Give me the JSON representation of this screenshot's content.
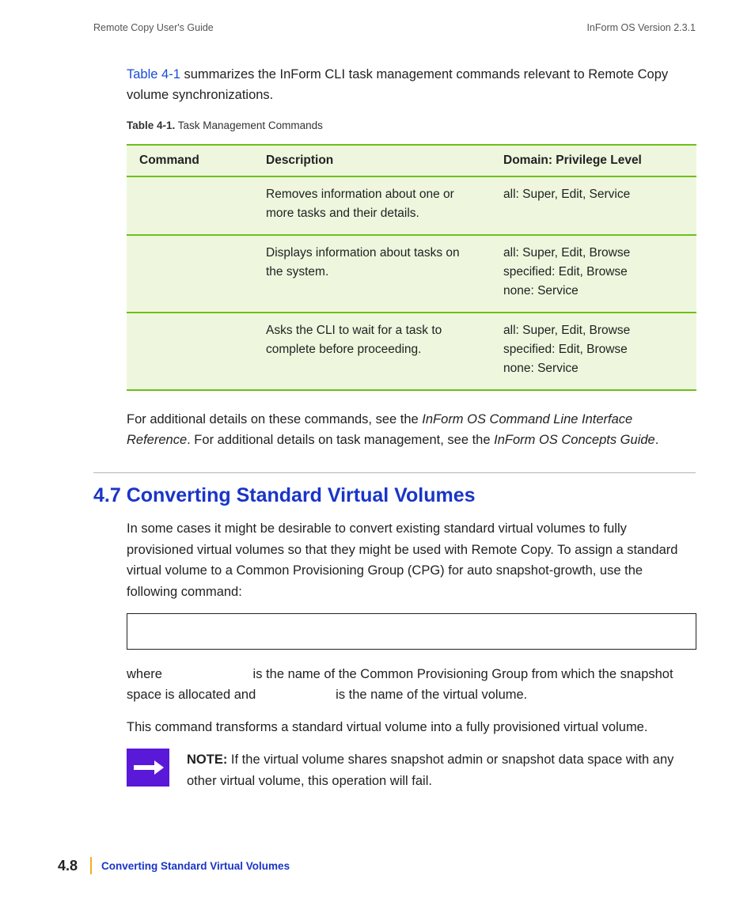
{
  "header": {
    "left": "Remote Copy User's Guide",
    "right": "InForm OS Version 2.3.1"
  },
  "intro": {
    "link": "Table 4-1",
    "rest": " summarizes the InForm CLI task management commands relevant to Remote Copy volume synchronizations."
  },
  "table": {
    "caption_label": "Table 4-1.",
    "caption_text": "  Task Management Commands",
    "headers": {
      "command": "Command",
      "description": "Description",
      "domain": "Domain: Privilege Level"
    },
    "rows": [
      {
        "command": "",
        "description": "Removes information about one or more tasks and their details.",
        "domain": "all: Super, Edit, Service"
      },
      {
        "command": "",
        "description": "Displays information about tasks on the system.",
        "domain": "all: Super, Edit, Browse\nspecified: Edit, Browse\nnone: Service"
      },
      {
        "command": "",
        "description": "Asks the CLI to wait for a task to complete before proceeding.",
        "domain": "all: Super, Edit, Browse\nspecified: Edit, Browse\nnone: Service"
      }
    ]
  },
  "after_table": {
    "p1_a": "For additional details on these commands, see the ",
    "p1_i1": "InForm OS Command Line Interface Reference",
    "p1_b": ". For additional details on task management, see the ",
    "p1_i2": "InForm OS Concepts Guide",
    "p1_c": "."
  },
  "section": {
    "heading": "4.7  Converting Standard Virtual Volumes",
    "p1": "In some cases it might be desirable to convert existing standard virtual volumes to fully provisioned virtual volumes so that they might be used with Remote Copy. To assign a standard virtual volume to a Common Provisioning Group (CPG) for auto snapshot-growth, use the following command:",
    "p2_a": "where ",
    "p2_gap1": "                       ",
    "p2_b": " is the name of the Common Provisioning Group from which the snapshot space is allocated and ",
    "p2_gap2": "                    ",
    "p2_c": " is the name of the virtual volume.",
    "p3": "This command transforms a standard virtual volume into a fully provisioned virtual volume."
  },
  "note": {
    "label": "NOTE:",
    "text": " If the virtual volume shares snapshot admin or snapshot data space with any other virtual volume, this operation will fail."
  },
  "footer": {
    "page": "4.8",
    "title": "Converting Standard Virtual Volumes"
  }
}
